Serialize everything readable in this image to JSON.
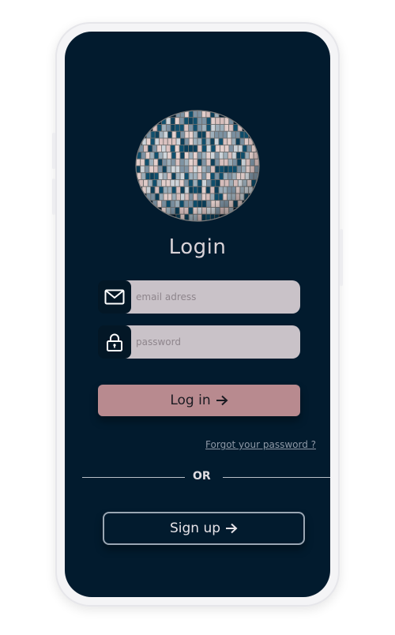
{
  "login": {
    "title": "Login",
    "email_placeholder": "email adress",
    "password_placeholder": "password",
    "login_label": "Log in",
    "forgot_label": "Forgot your password ?",
    "or_label": "OR",
    "signup_label": "Sign up"
  },
  "icons": {
    "logo": "disco-ball-icon",
    "email": "envelope-icon",
    "password": "lock-icon",
    "login_arrow": "arrow-right-icon",
    "signup_arrow": "arrow-right-icon"
  },
  "colors": {
    "screen_bg": "#021b2e",
    "field_bg": "#c9c2c8",
    "login_button": "#b88a8f",
    "signup_border": "#9aa6b3"
  }
}
